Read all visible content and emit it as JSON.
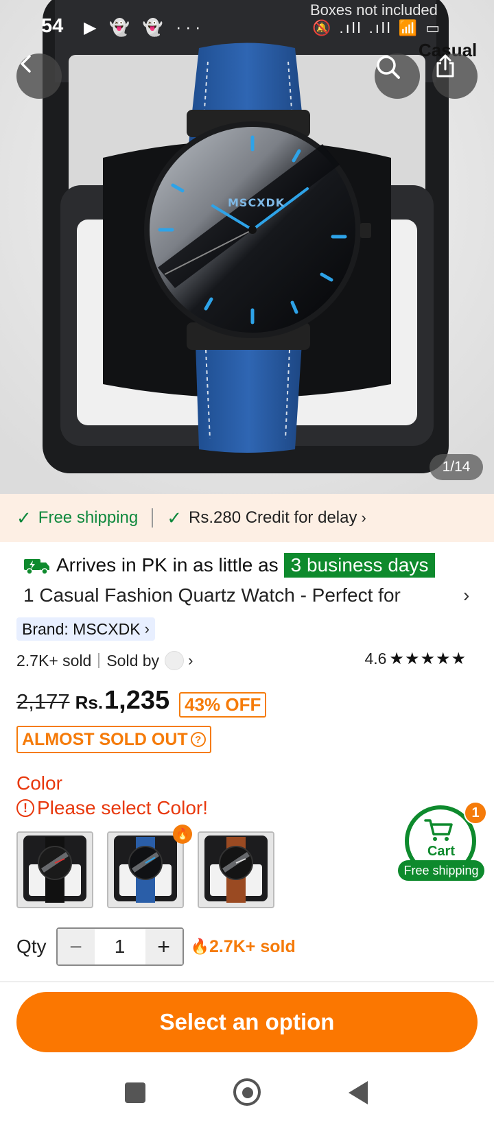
{
  "status_bar": {
    "time": "54",
    "left_icons": "▶ 👻 👻 ···",
    "right_icons": "🔕 .ıll .ıll 📶 ▭"
  },
  "hero": {
    "overlay_note": "Boxes not included",
    "tag": "Casual",
    "watch_brand": "MSCXDK",
    "page_counter": "1/14",
    "icons": {
      "back": "back-arrow-icon",
      "search": "search-icon",
      "share": "share-icon"
    }
  },
  "shipping_banner": {
    "free_shipping": "Free shipping",
    "credit": "Rs.280 Credit for delay"
  },
  "product": {
    "arrives_text": "Arrives in PK in as little as",
    "arrives_badge": "3 business days",
    "title": "1 Casual Fashion Quartz Watch - Perfect for",
    "brand": "Brand: MSCXDK",
    "sold_count": "2.7K+ sold",
    "sold_by": "Sold by",
    "rating": "4.6",
    "stars": "★★★★★",
    "old_price": "2,177",
    "currency": "Rs.",
    "new_price": "1,235",
    "discount": "43% OFF",
    "stock_badge": "ALMOST SOLD OUT"
  },
  "options": {
    "color_label": "Color",
    "color_warning": "Please select Color!",
    "swatches": [
      "Black",
      "Blue",
      "Brown"
    ]
  },
  "cart": {
    "label": "Cart",
    "count": "1",
    "shipping": "Free shipping"
  },
  "quantity": {
    "label": "Qty",
    "value": "1",
    "minus": "−",
    "plus": "+",
    "sold": "2.7K+ sold"
  },
  "cta": {
    "label": "Select an option"
  },
  "colors": {
    "accent": "#fb7701",
    "green": "#0e8a2d",
    "error": "#e8380d",
    "banner_bg": "#fdefe4"
  }
}
